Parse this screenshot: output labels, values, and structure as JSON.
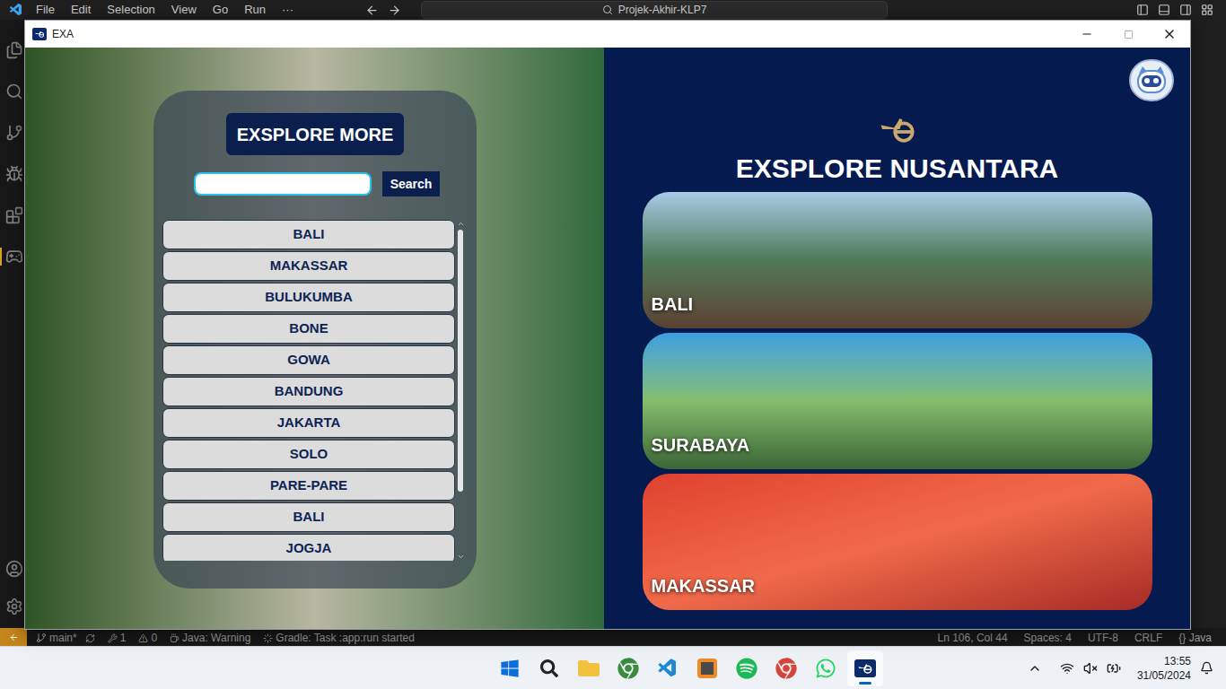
{
  "desktop": {
    "vscode": {
      "menu": [
        "File",
        "Edit",
        "Selection",
        "View",
        "Go",
        "Run",
        "···"
      ],
      "search": "Projek-Akhir-KLP7",
      "status_bar": {
        "branch": "main*",
        "ports": "1",
        "problems": "0",
        "java": "Java: Warning",
        "gradle": "Gradle: Task :app:run started",
        "right": [
          "Ln 106, Col 44",
          "Spaces: 4",
          "UTF-8",
          "CRLF",
          "{} Java"
        ]
      }
    },
    "taskbar": {
      "apps": [
        {
          "name": "start",
          "active": false
        },
        {
          "name": "search",
          "active": false
        },
        {
          "name": "explorer",
          "active": false
        },
        {
          "name": "chrome",
          "active": false
        },
        {
          "name": "vscode",
          "active": false
        },
        {
          "name": "sublime",
          "active": false
        },
        {
          "name": "spotify",
          "active": false
        },
        {
          "name": "chrome-profile",
          "active": false
        },
        {
          "name": "whatsapp",
          "active": false
        },
        {
          "name": "exa",
          "active": true
        }
      ],
      "time": "13:55",
      "date": "31/05/2024"
    }
  },
  "window": {
    "title": "EXA"
  },
  "explore_panel": {
    "title": "EXSPLORE MORE",
    "search": {
      "value": "",
      "button": "Search"
    },
    "items": [
      "BALI",
      "MAKASSAR",
      "BULUKUMBA",
      "BONE",
      "GOWA",
      "BANDUNG",
      "JAKARTA",
      "SOLO",
      "PARE-PARE",
      "BALI",
      "JOGJA"
    ]
  },
  "main": {
    "title": "EXSPLORE NUSANTARA",
    "cards": [
      {
        "label": "BALI",
        "photo": "bali"
      },
      {
        "label": "SURABAYA",
        "photo": "surabaya"
      },
      {
        "label": "MAKASSAR",
        "photo": "makassar"
      }
    ]
  }
}
